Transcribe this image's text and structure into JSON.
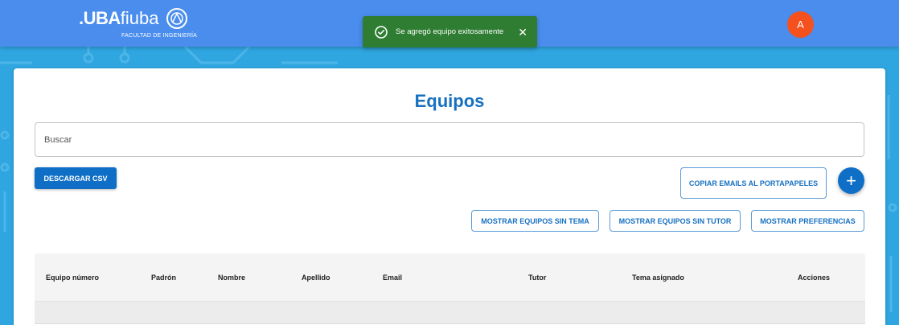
{
  "header": {
    "logo": {
      "uba": ".UBA",
      "fiuba": "fiuba",
      "subtitle": "FACULTAD DE INGENIERÍA"
    },
    "avatar_initial": "A",
    "colors": {
      "bar": "#4a8ded",
      "avatar": "#f4511e"
    }
  },
  "toast": {
    "message": "Se agregó equipo exitosamente",
    "icon": "check-circle-icon",
    "close_icon": "close-icon",
    "close_glyph": "✕",
    "color": "#2e7d32"
  },
  "main": {
    "title": "Equipos",
    "search": {
      "placeholder": "Buscar",
      "value": ""
    },
    "buttons": {
      "download_csv": "DESCARGAR CSV",
      "copy_emails": "COPIAR EMAILS AL PORTAPAPELES",
      "add_icon": "plus-icon",
      "add_glyph": "+",
      "show_without_topic": "MOSTRAR EQUIPOS SIN TEMA",
      "show_without_tutor": "MOSTRAR EQUIPOS SIN TUTOR",
      "show_preferences": "MOSTRAR PREFERENCIAS"
    },
    "table": {
      "columns": [
        "Equipo número",
        "Padrón",
        "Nombre",
        "Apellido",
        "Email",
        "Tutor",
        "Tema asignado",
        "Acciones"
      ]
    },
    "colors": {
      "primary": "#0f6fc6",
      "title": "#1670c0"
    }
  }
}
